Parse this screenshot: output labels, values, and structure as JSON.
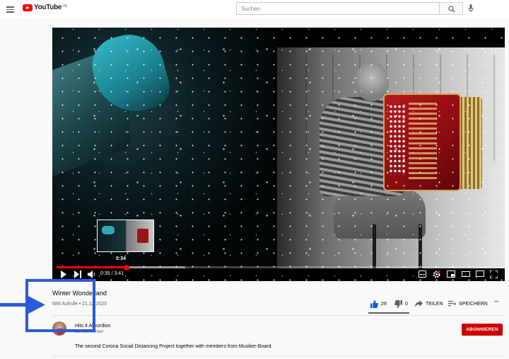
{
  "header": {
    "logo_text": "YouTube",
    "logo_region": "DE",
    "search_placeholder": "Suchen"
  },
  "player": {
    "preview_time": "0:34",
    "current_time": "0:35",
    "duration": "3:41",
    "time_display": "0:35 / 3:41",
    "progress_fraction": 0.158,
    "buffered_fraction": 0.29
  },
  "video": {
    "title": "Winter Wonderland",
    "views": "689 Aufrufe",
    "date": "21.12.2020",
    "meta": "689 Aufrufe • 21.12.2020"
  },
  "actions": {
    "likes": "29",
    "dislikes": "0",
    "share_label": "TEILEN",
    "save_label": "SPEICHERN",
    "more_label": "•••"
  },
  "channel": {
    "name": "Hits 4 Akkordion",
    "subscribers": "23 Abonnenten",
    "subscribe_label": "ABONNIEREN"
  },
  "description": "The second Corona Social Distancing Project together with members from Musiker-Board.",
  "colors": {
    "accent": "#ff0000",
    "subscribe": "#cc0000",
    "like_active": "#065fd4",
    "annotation": "#2a5ad8"
  }
}
